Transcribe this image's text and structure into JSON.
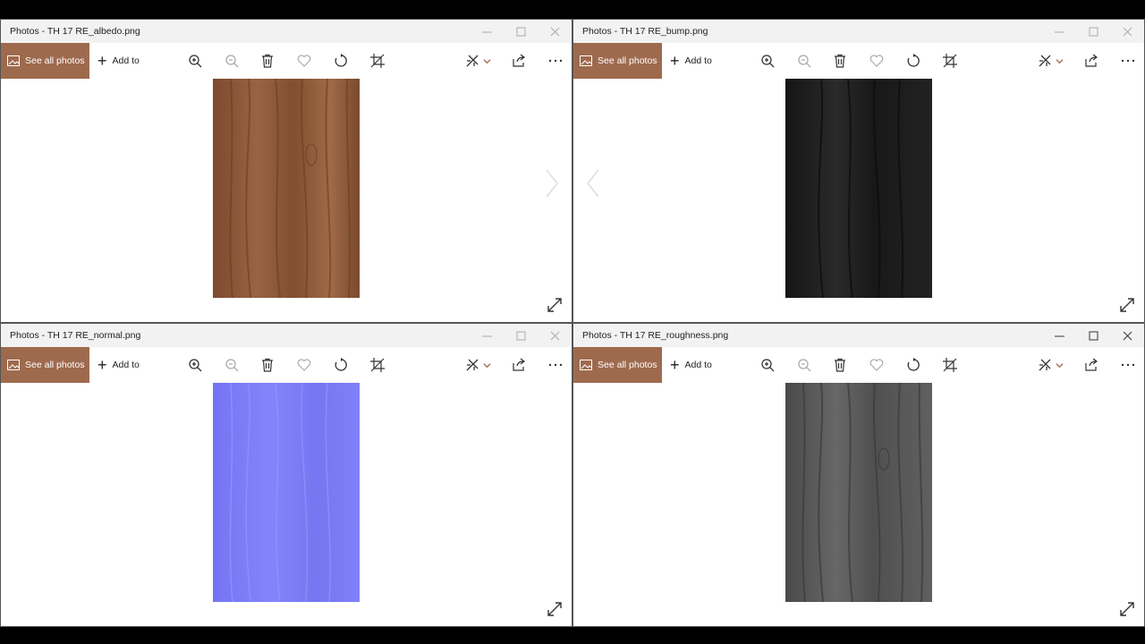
{
  "toolbar": {
    "see_all": "See all photos",
    "add_to": "Add to"
  },
  "windows": [
    {
      "title": "Photos - TH 17 RE_albedo.png",
      "photo": "albedo"
    },
    {
      "title": "Photos - TH 17 RE_bump.png",
      "photo": "bump"
    },
    {
      "title": "Photos - TH 17 RE_normal.png",
      "photo": "normal"
    },
    {
      "title": "Photos - TH 17 RE_roughness.png",
      "photo": "roughness"
    }
  ],
  "colors": {
    "accent": "#9e6a4e",
    "albedo": "#8a5636",
    "bump": "#1f1f1f",
    "normal": "#7c7cf6",
    "roughness": "#5a5a5a"
  },
  "icons": [
    "photos-icon",
    "plus-icon",
    "zoom-in-icon",
    "zoom-out-icon",
    "delete-icon",
    "favorite-icon",
    "rotate-icon",
    "crop-icon",
    "edit-icon",
    "chevron-down-icon",
    "share-icon",
    "more-icon",
    "minimize-icon",
    "maximize-icon",
    "close-icon",
    "expand-icon",
    "next-arrow-icon",
    "prev-arrow-icon"
  ]
}
